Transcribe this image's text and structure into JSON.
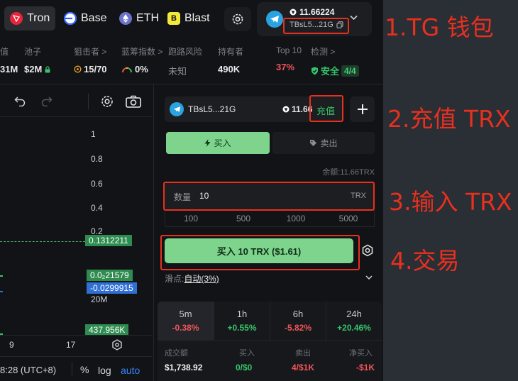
{
  "chains": [
    {
      "name": "Tron",
      "icon": "tron-icon",
      "color": "#e8243b"
    },
    {
      "name": "Base",
      "icon": "base-icon",
      "color": "#2e5fff"
    },
    {
      "name": "ETH",
      "icon": "eth-icon",
      "color": "#6c72c9"
    },
    {
      "name": "Blast",
      "icon": "blast-icon",
      "color": "#f6e73b"
    }
  ],
  "wallet": {
    "balance": "11.66224",
    "address": "TBsL5...21G"
  },
  "stats": [
    {
      "label": "值",
      "value": "31M"
    },
    {
      "label": "池子",
      "value": "$2M"
    },
    {
      "label": "狙击者 >",
      "value": "15/70"
    },
    {
      "label": "蓝筹指数 >",
      "value": "0%"
    },
    {
      "label": "跑路风险",
      "value": "未知"
    },
    {
      "label": "持有者",
      "value": "490K"
    },
    {
      "label": "Top 10",
      "value": "37%"
    },
    {
      "label": "检测 >",
      "value": "安全",
      "extra": "4/4"
    }
  ],
  "chart": {
    "yticks": [
      "1",
      "0.8",
      "0.6",
      "0.4",
      "0.2"
    ],
    "price_tag": "0.1312211",
    "tag_green": "0.0₂21579",
    "tag_blue": "-0.0299915",
    "vol_label": "20M",
    "vol_tag": "437.956K",
    "xticks": [
      "9",
      "17"
    ],
    "time": "8:28 (UTC+8)",
    "opt_pct": "%",
    "opt_log": "log",
    "opt_auto": "auto"
  },
  "trade": {
    "address": "TBsL5...21G",
    "balance": "11.66",
    "recharge": "充值",
    "tab_buy": "买入",
    "tab_sell": "卖出",
    "balance_text": "余额:11.66TRX",
    "qty_label": "数量",
    "qty_value": "10",
    "unit": "TRX",
    "amounts": [
      "100",
      "500",
      "1000",
      "5000"
    ],
    "buy_button": "买入 10 TRX ($1.61)",
    "slippage_label": "滑点:",
    "slippage_value": "自动(3%)"
  },
  "periods": [
    {
      "p": "5m",
      "c": "-0.38%"
    },
    {
      "p": "1h",
      "c": "+0.55%"
    },
    {
      "p": "6h",
      "c": "-5.82%"
    },
    {
      "p": "24h",
      "c": "+20.46%"
    }
  ],
  "summary": {
    "labels": [
      "成交额",
      "买入",
      "卖出",
      "净买入"
    ],
    "values": [
      "$1,738.92",
      "0/$0",
      "4/$1K",
      "-$1K"
    ]
  },
  "annotations": [
    "1.TG 钱包",
    "2.充值 TRX",
    "3.输入 TRX",
    "4.交易"
  ]
}
